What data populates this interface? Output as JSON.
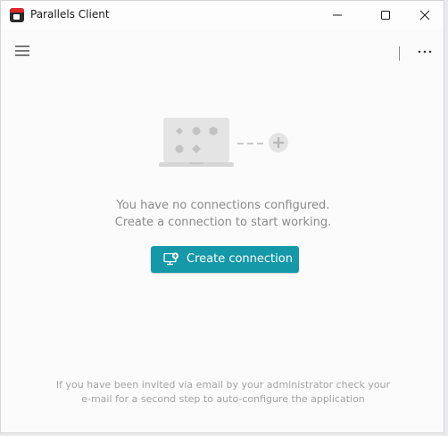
{
  "window": {
    "title": "Parallels Client",
    "controls": [
      "minimize-icon",
      "maximize-icon",
      "close-icon"
    ]
  },
  "toolbar": {
    "menu_icon": "hamburger-menu-icon",
    "more_icon": "more-horizontal-icon"
  },
  "empty_state": {
    "illustration": "laptop-with-add-icon",
    "line1": "You have no connections configured.",
    "line2": "Create a connection to start working.",
    "create_button": {
      "label": "Create connection",
      "icon": "add-connection-icon"
    }
  },
  "footer_hint": {
    "line1": "If you have been invited via email by your administrator check your",
    "line2": "e-mail for a second step to auto-configure the application"
  },
  "colors": {
    "accent": "#1599a8",
    "background": "#fbfbfb",
    "text_muted": "#8b8b8b"
  }
}
